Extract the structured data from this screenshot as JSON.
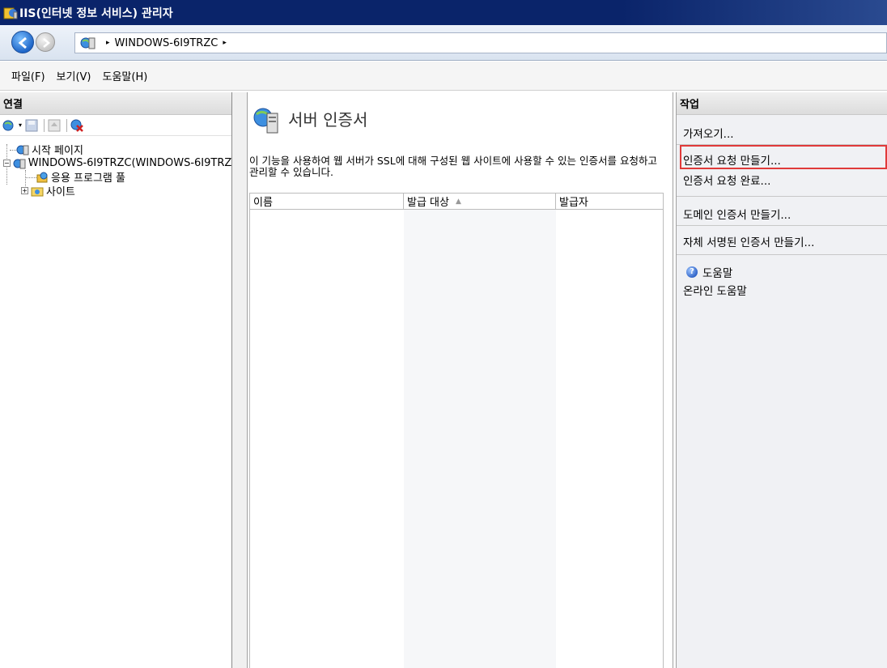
{
  "window": {
    "title": "IIS(인터넷 정보 서비스) 관리자"
  },
  "address": {
    "breadcrumb_server": "WINDOWS-6I9TRZC",
    "separator": "▸"
  },
  "menu": {
    "items": [
      "파일(F)",
      "보기(V)",
      "도움말(H)"
    ]
  },
  "connections": {
    "header": "연결",
    "tree": {
      "start_page": "시작 페이지",
      "server": "WINDOWS-6I9TRZC(WINDOWS-6I9TRZ",
      "app_pools": "응용 프로그램 풀",
      "sites": "사이트",
      "expanded_glyph": "−",
      "collapsed_glyph": "+"
    }
  },
  "main": {
    "title": "서버 인증서",
    "description": "이 기능을 사용하여 웹 서버가 SSL에 대해 구성된 웹 사이트에 사용할 수 있는 인증서를 요청하고 관리할 수 있습니다.",
    "table": {
      "columns": [
        "이름",
        "발급 대상",
        "발급자"
      ],
      "sort_indicator": "▲",
      "rows": []
    }
  },
  "actions": {
    "header": "작업",
    "items": {
      "import": "가져오기...",
      "create_request": "인증서 요청 만들기...",
      "complete_request": "인증서 요청 완료...",
      "create_domain": "도메인 인증서 만들기...",
      "create_self_signed": "자체 서명된 인증서 만들기...",
      "help": "도움말",
      "online_help": "온라인 도움말"
    },
    "help_glyph": "?",
    "highlight_color": "#e03a3a"
  },
  "colors": {
    "titlebar": "#0a246a",
    "actions_bg": "#f0f1f4"
  }
}
